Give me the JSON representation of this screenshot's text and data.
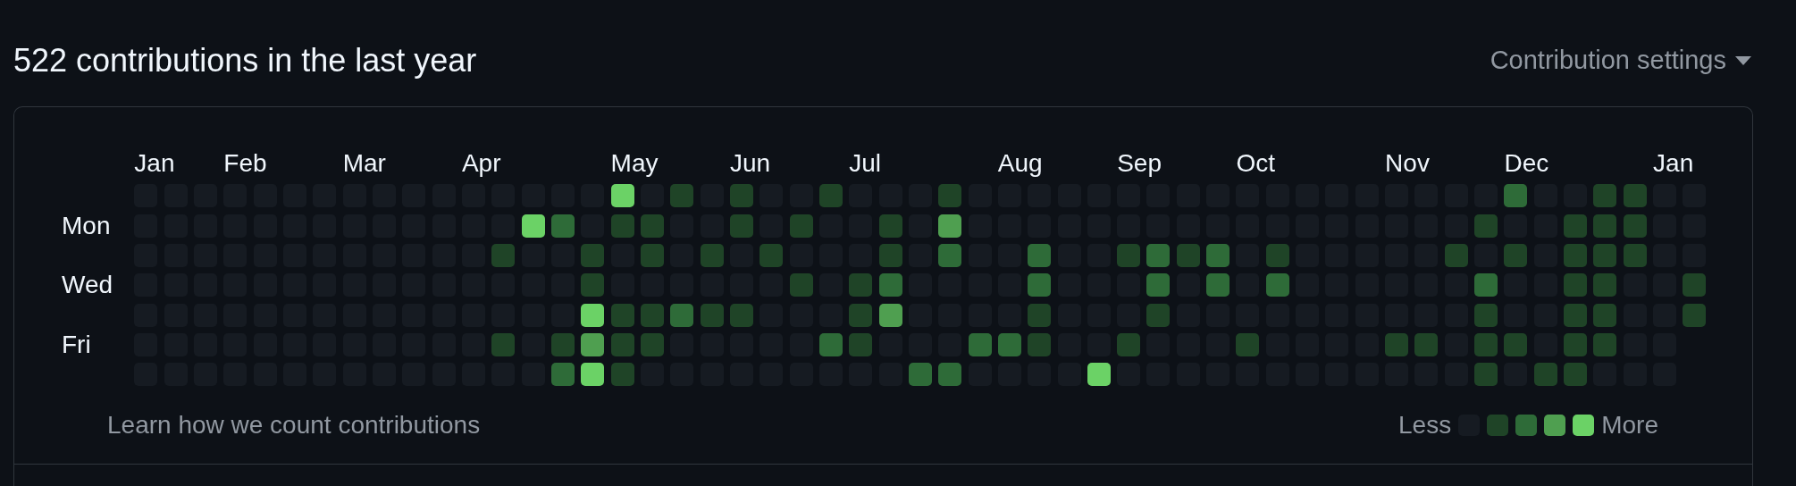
{
  "heading": "522 contributions in the last year",
  "settings_button": "Contribution settings",
  "day_labels": [
    "Mon",
    "Wed",
    "Fri"
  ],
  "weeks": [
    {
      "month": "Jan",
      "days": [
        {
          "color": "#161b22"
        },
        {
          "color": "#161b22"
        },
        {
          "color": "#161b22"
        },
        {
          "color": "#161b22"
        },
        {
          "color": "#161b22"
        },
        {
          "color": "#161b22"
        },
        {
          "color": "#161b22"
        }
      ]
    },
    {
      "days": [
        {
          "color": "#161b22"
        },
        {
          "color": "#161b22"
        },
        {
          "color": "#161b22"
        },
        {
          "color": "#161b22"
        },
        {
          "color": "#161b22"
        },
        {
          "color": "#161b22"
        },
        {
          "color": "#161b22"
        }
      ]
    },
    {
      "days": [
        {
          "color": "#161b22"
        },
        {
          "color": "#161b22"
        },
        {
          "color": "#161b22"
        },
        {
          "color": "#161b22"
        },
        {
          "color": "#161b22"
        },
        {
          "color": "#161b22"
        },
        {
          "color": "#161b22"
        }
      ]
    },
    {
      "month": "Feb",
      "days": [
        {
          "color": "#161b22"
        },
        {
          "color": "#161b22"
        },
        {
          "color": "#161b22"
        },
        {
          "color": "#161b22"
        },
        {
          "color": "#161b22"
        },
        {
          "color": "#161b22"
        },
        {
          "color": "#161b22"
        }
      ]
    },
    {
      "days": [
        {
          "color": "#161b22"
        },
        {
          "color": "#161b22"
        },
        {
          "color": "#161b22"
        },
        {
          "color": "#161b22"
        },
        {
          "color": "#161b22"
        },
        {
          "color": "#161b22"
        },
        {
          "color": "#161b22"
        }
      ]
    },
    {
      "days": [
        {
          "color": "#161b22"
        },
        {
          "color": "#161b22"
        },
        {
          "color": "#161b22"
        },
        {
          "color": "#161b22"
        },
        {
          "color": "#161b22"
        },
        {
          "color": "#161b22"
        },
        {
          "color": "#161b22"
        }
      ]
    },
    {
      "days": [
        {
          "color": "#161b22"
        },
        {
          "color": "#161b22"
        },
        {
          "color": "#161b22"
        },
        {
          "color": "#161b22"
        },
        {
          "color": "#161b22"
        },
        {
          "color": "#161b22"
        },
        {
          "color": "#161b22"
        }
      ]
    },
    {
      "month": "Mar",
      "days": [
        {
          "color": "#161b22"
        },
        {
          "color": "#161b22"
        },
        {
          "color": "#161b22"
        },
        {
          "color": "#161b22"
        },
        {
          "color": "#161b22"
        },
        {
          "color": "#161b22"
        },
        {
          "color": "#161b22"
        }
      ]
    },
    {
      "days": [
        {
          "color": "#161b22"
        },
        {
          "color": "#161b22"
        },
        {
          "color": "#161b22"
        },
        {
          "color": "#161b22"
        },
        {
          "color": "#161b22"
        },
        {
          "color": "#161b22"
        },
        {
          "color": "#161b22"
        }
      ]
    },
    {
      "days": [
        {
          "color": "#161b22"
        },
        {
          "color": "#161b22"
        },
        {
          "color": "#161b22"
        },
        {
          "color": "#161b22"
        },
        {
          "color": "#161b22"
        },
        {
          "color": "#161b22"
        },
        {
          "color": "#161b22"
        }
      ]
    },
    {
      "days": [
        {
          "color": "#161b22"
        },
        {
          "color": "#161b22"
        },
        {
          "color": "#161b22"
        },
        {
          "color": "#161b22"
        },
        {
          "color": "#161b22"
        },
        {
          "color": "#161b22"
        },
        {
          "color": "#161b22"
        }
      ]
    },
    {
      "month": "Apr",
      "days": [
        {
          "color": "#161b22"
        },
        {
          "color": "#161b22"
        },
        {
          "color": "#161b22"
        },
        {
          "color": "#161b22"
        },
        {
          "color": "#161b22"
        },
        {
          "color": "#161b22"
        },
        {
          "color": "#161b22"
        }
      ]
    },
    {
      "days": [
        {
          "color": "#161b22"
        },
        {
          "color": "#161b22"
        },
        {
          "color": "#1f4427"
        },
        {
          "color": "#161b22"
        },
        {
          "color": "#161b22"
        },
        {
          "color": "#1f4427"
        },
        {
          "color": "#161b22"
        }
      ]
    },
    {
      "days": [
        {
          "color": "#161b22"
        },
        {
          "color": "#6bd266"
        },
        {
          "color": "#161b22"
        },
        {
          "color": "#161b22"
        },
        {
          "color": "#161b22"
        },
        {
          "color": "#161b22"
        },
        {
          "color": "#161b22"
        }
      ]
    },
    {
      "days": [
        {
          "color": "#161b22"
        },
        {
          "color": "#2e6b38"
        },
        {
          "color": "#161b22"
        },
        {
          "color": "#161b22"
        },
        {
          "color": "#161b22"
        },
        {
          "color": "#1f4427"
        },
        {
          "color": "#2e6b38"
        }
      ]
    },
    {
      "days": [
        {
          "color": "#161b22"
        },
        {
          "color": "#161b22"
        },
        {
          "color": "#1f4427"
        },
        {
          "color": "#1f4427"
        },
        {
          "color": "#6bd266"
        },
        {
          "color": "#4f9f50"
        },
        {
          "color": "#6bd266"
        }
      ]
    },
    {
      "month": "May",
      "days": [
        {
          "color": "#6bd266"
        },
        {
          "color": "#1f4427"
        },
        {
          "color": "#161b22"
        },
        {
          "color": "#161b22"
        },
        {
          "color": "#1f4427"
        },
        {
          "color": "#1f4427"
        },
        {
          "color": "#1f4427"
        }
      ]
    },
    {
      "days": [
        {
          "color": "#161b22"
        },
        {
          "color": "#1f4427"
        },
        {
          "color": "#1f4427"
        },
        {
          "color": "#161b22"
        },
        {
          "color": "#1f4427"
        },
        {
          "color": "#1f4427"
        },
        {
          "color": "#161b22"
        }
      ]
    },
    {
      "days": [
        {
          "color": "#1f4427"
        },
        {
          "color": "#161b22"
        },
        {
          "color": "#161b22"
        },
        {
          "color": "#161b22"
        },
        {
          "color": "#2e6b38"
        },
        {
          "color": "#161b22"
        },
        {
          "color": "#161b22"
        }
      ]
    },
    {
      "days": [
        {
          "color": "#161b22"
        },
        {
          "color": "#161b22"
        },
        {
          "color": "#1f4427"
        },
        {
          "color": "#161b22"
        },
        {
          "color": "#1f4427"
        },
        {
          "color": "#161b22"
        },
        {
          "color": "#161b22"
        }
      ]
    },
    {
      "month": "Jun",
      "days": [
        {
          "color": "#1f4427"
        },
        {
          "color": "#1f4427"
        },
        {
          "color": "#161b22"
        },
        {
          "color": "#161b22"
        },
        {
          "color": "#1f4427"
        },
        {
          "color": "#161b22"
        },
        {
          "color": "#161b22"
        }
      ]
    },
    {
      "days": [
        {
          "color": "#161b22"
        },
        {
          "color": "#161b22"
        },
        {
          "color": "#1f4427"
        },
        {
          "color": "#161b22"
        },
        {
          "color": "#161b22"
        },
        {
          "color": "#161b22"
        },
        {
          "color": "#161b22"
        }
      ]
    },
    {
      "days": [
        {
          "color": "#161b22"
        },
        {
          "color": "#1f4427"
        },
        {
          "color": "#161b22"
        },
        {
          "color": "#1f4427"
        },
        {
          "color": "#161b22"
        },
        {
          "color": "#161b22"
        },
        {
          "color": "#161b22"
        }
      ]
    },
    {
      "days": [
        {
          "color": "#1f4427"
        },
        {
          "color": "#161b22"
        },
        {
          "color": "#161b22"
        },
        {
          "color": "#161b22"
        },
        {
          "color": "#161b22"
        },
        {
          "color": "#2e6b38"
        },
        {
          "color": "#161b22"
        }
      ]
    },
    {
      "month": "Jul",
      "days": [
        {
          "color": "#161b22"
        },
        {
          "color": "#161b22"
        },
        {
          "color": "#161b22"
        },
        {
          "color": "#1f4427"
        },
        {
          "color": "#1f4427"
        },
        {
          "color": "#1f4427"
        },
        {
          "color": "#161b22"
        }
      ]
    },
    {
      "days": [
        {
          "color": "#161b22"
        },
        {
          "color": "#1f4427"
        },
        {
          "color": "#1f4427"
        },
        {
          "color": "#2e6b38"
        },
        {
          "color": "#4f9f50"
        },
        {
          "color": "#161b22"
        },
        {
          "color": "#161b22"
        }
      ]
    },
    {
      "days": [
        {
          "color": "#161b22"
        },
        {
          "color": "#161b22"
        },
        {
          "color": "#161b22"
        },
        {
          "color": "#161b22"
        },
        {
          "color": "#161b22"
        },
        {
          "color": "#161b22"
        },
        {
          "color": "#2e6b38"
        }
      ]
    },
    {
      "days": [
        {
          "color": "#1f4427"
        },
        {
          "color": "#4f9f50"
        },
        {
          "color": "#2e6b38"
        },
        {
          "color": "#161b22"
        },
        {
          "color": "#161b22"
        },
        {
          "color": "#161b22"
        },
        {
          "color": "#2e6b38"
        }
      ]
    },
    {
      "days": [
        {
          "color": "#161b22"
        },
        {
          "color": "#161b22"
        },
        {
          "color": "#161b22"
        },
        {
          "color": "#161b22"
        },
        {
          "color": "#161b22"
        },
        {
          "color": "#2e6b38"
        },
        {
          "color": "#161b22"
        }
      ]
    },
    {
      "month": "Aug",
      "days": [
        {
          "color": "#161b22"
        },
        {
          "color": "#161b22"
        },
        {
          "color": "#161b22"
        },
        {
          "color": "#161b22"
        },
        {
          "color": "#161b22"
        },
        {
          "color": "#2e6b38"
        },
        {
          "color": "#161b22"
        }
      ]
    },
    {
      "days": [
        {
          "color": "#161b22"
        },
        {
          "color": "#161b22"
        },
        {
          "color": "#2e6b38"
        },
        {
          "color": "#2e6b38"
        },
        {
          "color": "#1f4427"
        },
        {
          "color": "#1f4427"
        },
        {
          "color": "#161b22"
        }
      ]
    },
    {
      "days": [
        {
          "color": "#161b22"
        },
        {
          "color": "#161b22"
        },
        {
          "color": "#161b22"
        },
        {
          "color": "#161b22"
        },
        {
          "color": "#161b22"
        },
        {
          "color": "#161b22"
        },
        {
          "color": "#161b22"
        }
      ]
    },
    {
      "days": [
        {
          "color": "#161b22"
        },
        {
          "color": "#161b22"
        },
        {
          "color": "#161b22"
        },
        {
          "color": "#161b22"
        },
        {
          "color": "#161b22"
        },
        {
          "color": "#161b22"
        },
        {
          "color": "#6bd266"
        }
      ]
    },
    {
      "month": "Sep",
      "days": [
        {
          "color": "#161b22"
        },
        {
          "color": "#161b22"
        },
        {
          "color": "#1f4427"
        },
        {
          "color": "#161b22"
        },
        {
          "color": "#161b22"
        },
        {
          "color": "#1f4427"
        },
        {
          "color": "#161b22"
        }
      ]
    },
    {
      "days": [
        {
          "color": "#161b22"
        },
        {
          "color": "#161b22"
        },
        {
          "color": "#2e6b38"
        },
        {
          "color": "#2e6b38"
        },
        {
          "color": "#1f4427"
        },
        {
          "color": "#161b22"
        },
        {
          "color": "#161b22"
        }
      ]
    },
    {
      "days": [
        {
          "color": "#161b22"
        },
        {
          "color": "#161b22"
        },
        {
          "color": "#1f4427"
        },
        {
          "color": "#161b22"
        },
        {
          "color": "#161b22"
        },
        {
          "color": "#161b22"
        },
        {
          "color": "#161b22"
        }
      ]
    },
    {
      "days": [
        {
          "color": "#161b22"
        },
        {
          "color": "#161b22"
        },
        {
          "color": "#2e6b38"
        },
        {
          "color": "#2e6b38"
        },
        {
          "color": "#161b22"
        },
        {
          "color": "#161b22"
        },
        {
          "color": "#161b22"
        }
      ]
    },
    {
      "month": "Oct",
      "days": [
        {
          "color": "#161b22"
        },
        {
          "color": "#161b22"
        },
        {
          "color": "#161b22"
        },
        {
          "color": "#161b22"
        },
        {
          "color": "#161b22"
        },
        {
          "color": "#1f4427"
        },
        {
          "color": "#161b22"
        }
      ]
    },
    {
      "days": [
        {
          "color": "#161b22"
        },
        {
          "color": "#161b22"
        },
        {
          "color": "#1f4427"
        },
        {
          "color": "#2e6b38"
        },
        {
          "color": "#161b22"
        },
        {
          "color": "#161b22"
        },
        {
          "color": "#161b22"
        }
      ]
    },
    {
      "days": [
        {
          "color": "#161b22"
        },
        {
          "color": "#161b22"
        },
        {
          "color": "#161b22"
        },
        {
          "color": "#161b22"
        },
        {
          "color": "#161b22"
        },
        {
          "color": "#161b22"
        },
        {
          "color": "#161b22"
        }
      ]
    },
    {
      "days": [
        {
          "color": "#161b22"
        },
        {
          "color": "#161b22"
        },
        {
          "color": "#161b22"
        },
        {
          "color": "#161b22"
        },
        {
          "color": "#161b22"
        },
        {
          "color": "#161b22"
        },
        {
          "color": "#161b22"
        }
      ]
    },
    {
      "days": [
        {
          "color": "#161b22"
        },
        {
          "color": "#161b22"
        },
        {
          "color": "#161b22"
        },
        {
          "color": "#161b22"
        },
        {
          "color": "#161b22"
        },
        {
          "color": "#161b22"
        },
        {
          "color": "#161b22"
        }
      ]
    },
    {
      "month": "Nov",
      "days": [
        {
          "color": "#161b22"
        },
        {
          "color": "#161b22"
        },
        {
          "color": "#161b22"
        },
        {
          "color": "#161b22"
        },
        {
          "color": "#161b22"
        },
        {
          "color": "#1f4427"
        },
        {
          "color": "#161b22"
        }
      ]
    },
    {
      "days": [
        {
          "color": "#161b22"
        },
        {
          "color": "#161b22"
        },
        {
          "color": "#161b22"
        },
        {
          "color": "#161b22"
        },
        {
          "color": "#161b22"
        },
        {
          "color": "#1f4427"
        },
        {
          "color": "#161b22"
        }
      ]
    },
    {
      "days": [
        {
          "color": "#161b22"
        },
        {
          "color": "#161b22"
        },
        {
          "color": "#1f4427"
        },
        {
          "color": "#161b22"
        },
        {
          "color": "#161b22"
        },
        {
          "color": "#161b22"
        },
        {
          "color": "#161b22"
        }
      ]
    },
    {
      "days": [
        {
          "color": "#161b22"
        },
        {
          "color": "#1f4427"
        },
        {
          "color": "#161b22"
        },
        {
          "color": "#2e6b38"
        },
        {
          "color": "#1f4427"
        },
        {
          "color": "#1f4427"
        },
        {
          "color": "#1f4427"
        }
      ]
    },
    {
      "month": "Dec",
      "days": [
        {
          "color": "#2e6b38"
        },
        {
          "color": "#161b22"
        },
        {
          "color": "#1f4427"
        },
        {
          "color": "#161b22"
        },
        {
          "color": "#161b22"
        },
        {
          "color": "#1f4427"
        },
        {
          "color": "#161b22"
        }
      ]
    },
    {
      "days": [
        {
          "color": "#161b22"
        },
        {
          "color": "#161b22"
        },
        {
          "color": "#161b22"
        },
        {
          "color": "#161b22"
        },
        {
          "color": "#161b22"
        },
        {
          "color": "#161b22"
        },
        {
          "color": "#1f4427"
        }
      ]
    },
    {
      "days": [
        {
          "color": "#161b22"
        },
        {
          "color": "#1f4427"
        },
        {
          "color": "#1f4427"
        },
        {
          "color": "#1f4427"
        },
        {
          "color": "#1f4427"
        },
        {
          "color": "#1f4427"
        },
        {
          "color": "#1f4427"
        }
      ]
    },
    {
      "days": [
        {
          "color": "#1f4427"
        },
        {
          "color": "#1f4427"
        },
        {
          "color": "#1f4427"
        },
        {
          "color": "#1f4427"
        },
        {
          "color": "#1f4427"
        },
        {
          "color": "#1f4427"
        },
        {
          "color": "#161b22"
        }
      ]
    },
    {
      "days": [
        {
          "color": "#1f4427"
        },
        {
          "color": "#1f4427"
        },
        {
          "color": "#1f4427"
        },
        {
          "color": "#161b22"
        },
        {
          "color": "#161b22"
        },
        {
          "color": "#161b22"
        },
        {
          "color": "#161b22"
        }
      ]
    },
    {
      "month": "Jan",
      "days": [
        {
          "color": "#161b22"
        },
        {
          "color": "#161b22"
        },
        {
          "color": "#161b22"
        },
        {
          "color": "#161b22"
        },
        {
          "color": "#161b22"
        },
        {
          "color": "#161b22"
        },
        {
          "color": "#161b22"
        }
      ]
    },
    {
      "days": [
        {
          "color": "#161b22"
        },
        {
          "color": "#161b22"
        },
        {
          "color": "#161b22"
        },
        {
          "color": "#1f4427"
        },
        {
          "color": "#1f4427"
        }
      ]
    }
  ],
  "learn_link": "Learn how we count contributions",
  "legend": {
    "less": "Less",
    "more": "More",
    "swatches": [
      {
        "color": "#161b22"
      },
      {
        "color": "#1f4427"
      },
      {
        "color": "#2e6b38"
      },
      {
        "color": "#4f9f50"
      },
      {
        "color": "#6bd266"
      }
    ]
  }
}
